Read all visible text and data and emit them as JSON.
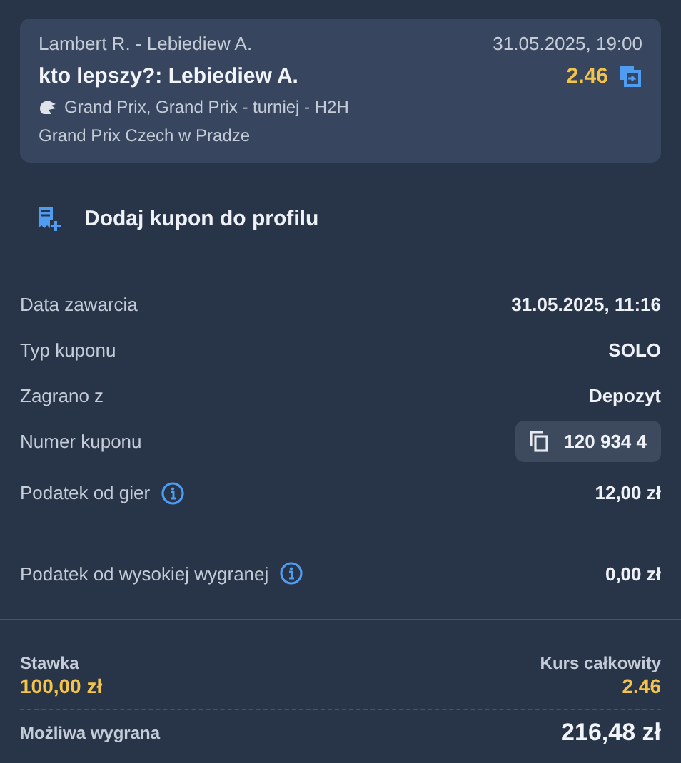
{
  "event": {
    "teams": "Lambert R. - Lebiediew A.",
    "datetime": "31.05.2025, 19:00",
    "selection": "kto lepszy?: Lebiediew A.",
    "odds": "2.46",
    "competition": "Grand Prix, Grand Prix - turniej - H2H",
    "venue": "Grand Prix Czech w Pradze"
  },
  "add_coupon": {
    "label": "Dodaj kupon do profilu"
  },
  "details": [
    {
      "label": "Data zawarcia",
      "value": "31.05.2025, 11:16",
      "kind": "plain",
      "info": false
    },
    {
      "label": "Typ kuponu",
      "value": "SOLO",
      "kind": "plain",
      "info": false
    },
    {
      "label": "Zagrano z",
      "value": "Depozyt",
      "kind": "plain",
      "info": false
    },
    {
      "label": "Numer kuponu",
      "value": "120 934 4",
      "kind": "copy",
      "info": false
    },
    {
      "label": "Podatek od gier",
      "value": "12,00 zł",
      "kind": "plain",
      "info": true
    },
    {
      "label": "Podatek od wysokiej wygranej",
      "value": "0,00 zł",
      "kind": "plain",
      "info": true
    }
  ],
  "summary": {
    "stake_label": "Stawka",
    "stake": "100,00 zł",
    "total_odds_label": "Kurs całkowity",
    "total_odds": "2.46",
    "win_label": "Możliwa wygrana",
    "win": "216,48 zł"
  }
}
